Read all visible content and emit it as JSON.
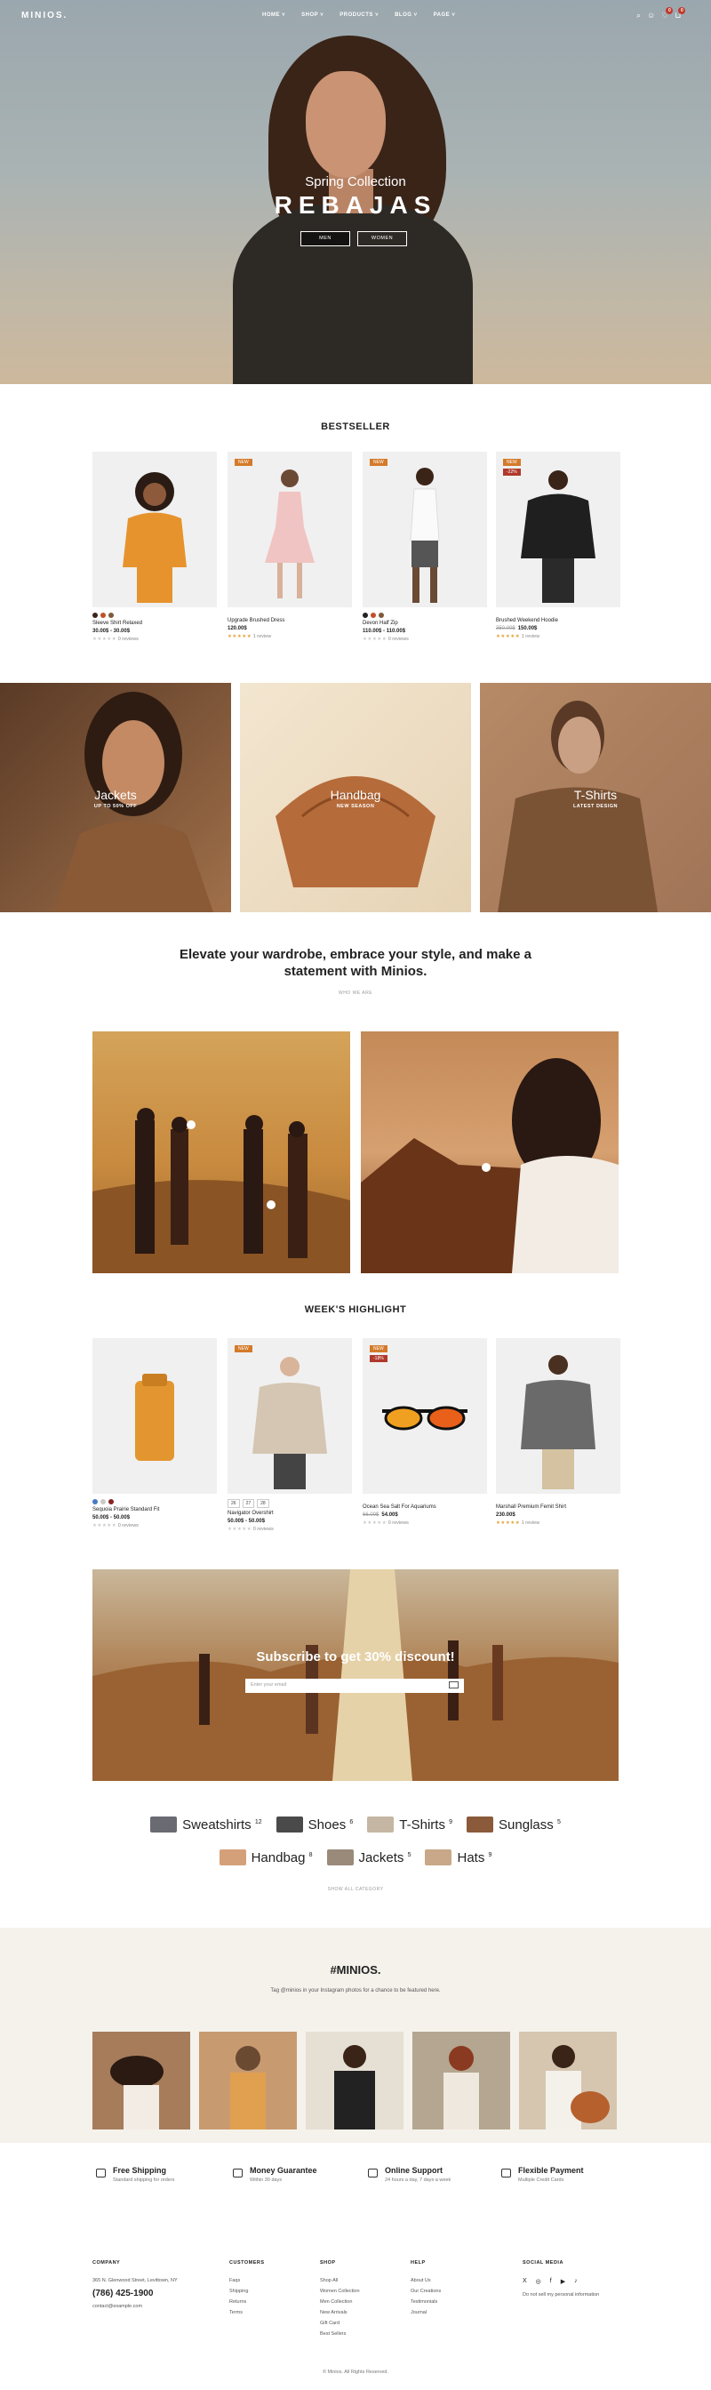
{
  "header": {
    "logo": "MINIOS.",
    "nav": [
      "HOME ˅",
      "SHOP ˅",
      "PRODUCTS ˅",
      "BLOG ˅",
      "PAGE ˅"
    ],
    "wishlist_count": "0",
    "cart_count": "0"
  },
  "hero": {
    "subtitle": "Spring Collection",
    "title": "REBAJAS",
    "btn_men": "MEN",
    "btn_women": "WOMEN"
  },
  "bestseller": {
    "title": "BESTSELLER",
    "products": [
      {
        "name": "Sleeve Shirt Relaxed",
        "price": "30.00$ - 30.00$",
        "reviews": "0 reviews",
        "tag": "",
        "tag2": ""
      },
      {
        "name": "Upgrade Brushed Dress",
        "price": "120.00$",
        "reviews": "1 review",
        "tag": "NEW",
        "tag2": ""
      },
      {
        "name": "Devon Half Zip",
        "price": "110.00$ - 110.00$",
        "reviews": "0 reviews",
        "tag": "NEW",
        "tag2": ""
      },
      {
        "name": "Brushed Weekend Hoodie",
        "old_price": "350.00$",
        "price": "150.00$",
        "reviews": "1 review",
        "tag": "NEW",
        "tag2": "-22%"
      }
    ]
  },
  "categories": [
    {
      "name": "Jackets",
      "sub": "UP TO 50% OFF"
    },
    {
      "name": "Handbag",
      "sub": "NEW SEASON"
    },
    {
      "name": "T-Shirts",
      "sub": "LATEST DESIGN"
    }
  ],
  "about": {
    "quote": "Elevate your wardrobe, embrace your style, and make a statement with Minios.",
    "link": "WHO WE ARE"
  },
  "highlight": {
    "title": "WEEK'S HIGHLIGHT",
    "products": [
      {
        "name": "Sequoia Prairie Standard Fit",
        "price": "50.00$ - 50.00$",
        "reviews": "0 reviews",
        "tag": "",
        "tag2": ""
      },
      {
        "name": "Navigator Overshirt",
        "price": "50.00$ - 50.00$",
        "reviews": "0 reviews",
        "tag": "NEW",
        "tag2": "",
        "sizes": [
          "26",
          "27",
          "28"
        ]
      },
      {
        "name": "Ocean Sea Salt For Aquariums",
        "old_price": "66.00$",
        "price": "54.00$",
        "reviews": "0 reviews",
        "tag": "NEW",
        "tag2": "-18%"
      },
      {
        "name": "Marshall Premium Femit Shirt",
        "price": "230.00$",
        "reviews": "1 review",
        "tag": "",
        "tag2": ""
      }
    ]
  },
  "subscribe": {
    "title": "Subscribe to get 30% discount!",
    "placeholder": "Enter your email"
  },
  "category_tags": [
    {
      "label": "Sweatshirts",
      "count": "12"
    },
    {
      "label": "Shoes",
      "count": "6"
    },
    {
      "label": "T-Shirts",
      "count": "9"
    },
    {
      "label": "Sunglass",
      "count": "5"
    },
    {
      "label": "Handbag",
      "count": "8"
    },
    {
      "label": "Jackets",
      "count": "5"
    },
    {
      "label": "Hats",
      "count": "9"
    }
  ],
  "show_all": "SHOW ALL CATEGORY",
  "instagram": {
    "title": "#MINIOS.",
    "desc": "Tag @minios in your Instagram photos for a chance to be featured here."
  },
  "features": [
    {
      "title": "Free Shipping",
      "desc": "Standard shipping for orders"
    },
    {
      "title": "Money Guarantee",
      "desc": "Within 30 days"
    },
    {
      "title": "Online Support",
      "desc": "24 hours a day, 7 days a week"
    },
    {
      "title": "Flexible Payment",
      "desc": "Multiple Credit Cards"
    }
  ],
  "footer": {
    "company_head": "COMPANY",
    "address": "365 N. Glenwood Street, Levittown, NY",
    "phone": "(786) 425-1900",
    "email": "contact@example.com",
    "customers_head": "CUSTOMERS",
    "customers": [
      "Faqs",
      "Shipping",
      "Returns",
      "Terms"
    ],
    "shop_head": "SHOP",
    "shop": [
      "Shop All",
      "Women Collection",
      "Men Collection",
      "New Arrivals",
      "Gift Card",
      "Best Sellers"
    ],
    "help_head": "HELP",
    "help": [
      "About Us",
      "Our Creations",
      "Testimonials",
      "Journal"
    ],
    "social_head": "SOCIAL MEDIA",
    "social_icons": [
      "X",
      "◎",
      "f",
      "▶",
      "♪"
    ],
    "privacy": "Do not sell my personal information",
    "copyright": "© Minios. All Rights Reserved."
  }
}
